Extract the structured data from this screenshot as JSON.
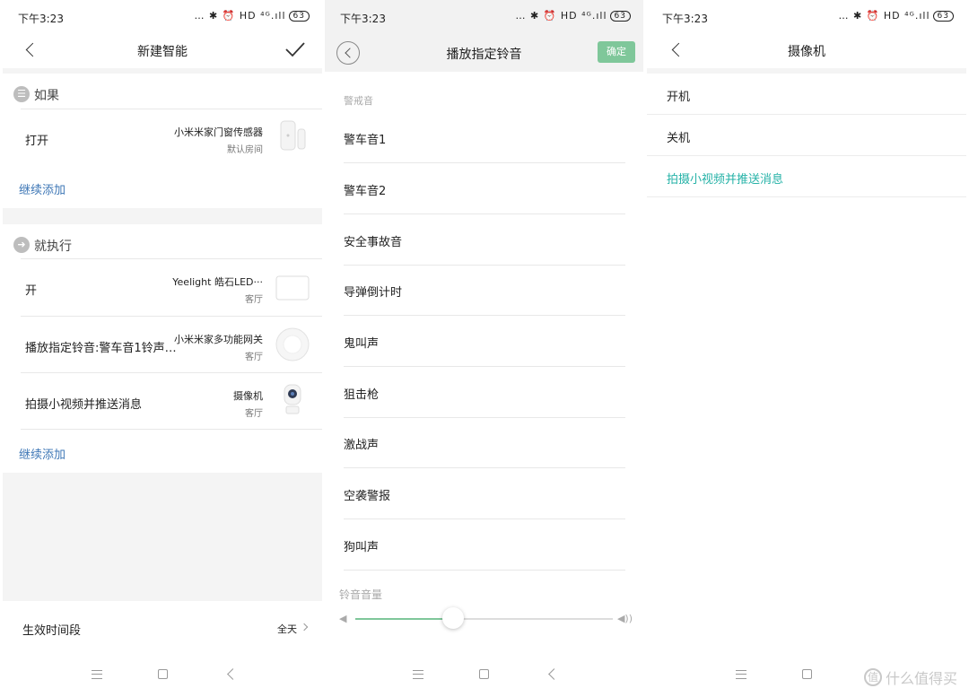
{
  "status_bar": {
    "time": "下午3:23",
    "icons_text": "… ✱ ⏰ HD ⁴ᴳ.ıll",
    "battery": "63"
  },
  "panel1": {
    "title": "新建智能",
    "if_section": {
      "icon": "list-icon",
      "label": "如果"
    },
    "if_rows": [
      {
        "action": "打开",
        "device": "小米米家门窗传感器",
        "room": "默认房间"
      }
    ],
    "add_more_1": "继续添加",
    "then_section": {
      "icon": "arrow-right-icon",
      "label": "就执行"
    },
    "then_rows": [
      {
        "action": "开",
        "device": "Yeelight 皓石LED···",
        "room": "客厅"
      },
      {
        "action": "播放指定铃音:警车音1铃声…",
        "device": "小米米家多功能网关",
        "room": "客厅"
      },
      {
        "action": "拍摄小视频并推送消息",
        "device": "摄像机",
        "room": "客厅"
      }
    ],
    "add_more_2": "继续添加",
    "time_range": {
      "label": "生效时间段",
      "value": "全天"
    }
  },
  "panel2": {
    "title": "播放指定铃音",
    "confirm": "确定",
    "category": "警戒音",
    "ringtones": [
      "警车音1",
      "警车音2",
      "安全事故音",
      "导弹倒计时",
      "鬼叫声",
      "狙击枪",
      "激战声",
      "空袭警报",
      "狗叫声"
    ],
    "volume_label": "铃音音量",
    "volume_fraction": 0.38
  },
  "panel3": {
    "title": "摄像机",
    "options": [
      "开机",
      "关机",
      "拍摄小视频并推送消息"
    ],
    "active_index": 2
  },
  "watermark": {
    "text": "什么值得买",
    "logo": "值"
  },
  "colors": {
    "link": "#3e77b6",
    "accent_green": "#7fc79a",
    "active_teal": "#25b2a7",
    "gray_bg": "#f4f4f4"
  }
}
